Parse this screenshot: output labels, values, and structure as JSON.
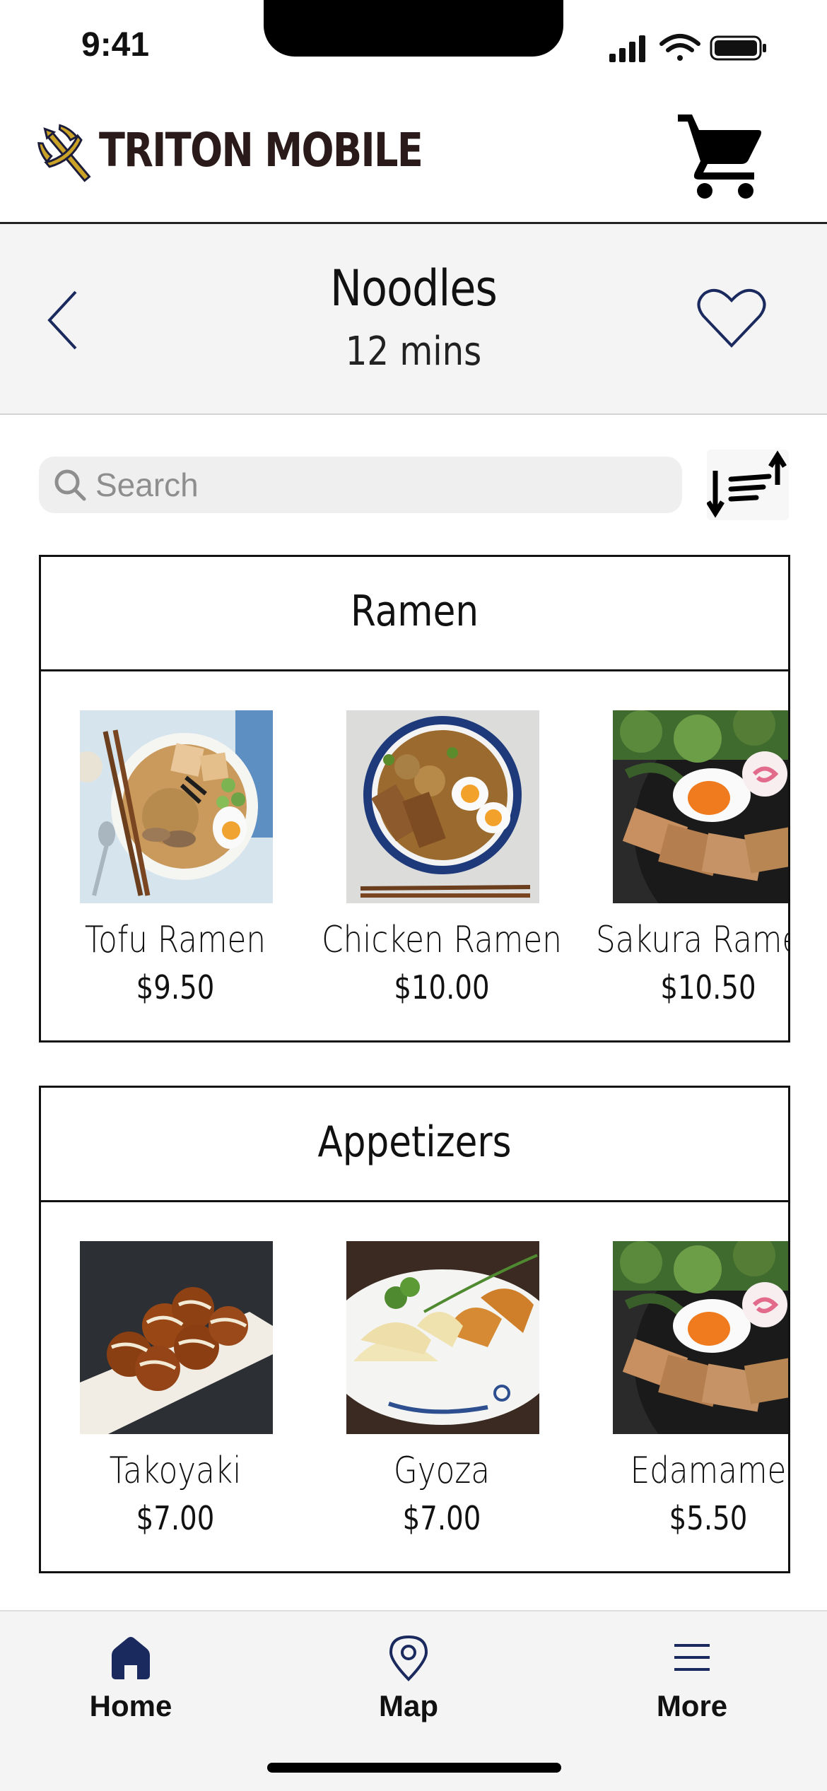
{
  "status_bar": {
    "time": "9:41"
  },
  "brand": {
    "name": "TRITON MOBILE",
    "accent_color": "#c9a227",
    "navy": "#1b2a5e"
  },
  "header": {
    "cart_icon": "cart-icon"
  },
  "category": {
    "title": "Noodles",
    "subtitle": "12 mins",
    "back_icon": "chevron-left-icon",
    "favorite_icon": "heart-icon"
  },
  "search": {
    "placeholder": "Search",
    "value": "",
    "sort_icon": "sort-icon"
  },
  "sections": [
    {
      "title": "Ramen",
      "items": [
        {
          "name": "Tofu Ramen",
          "price": "$9.50"
        },
        {
          "name": "Chicken Ramen",
          "price": "$10.00"
        },
        {
          "name": "Sakura Ramen",
          "price": "$10.50"
        }
      ]
    },
    {
      "title": "Appetizers",
      "items": [
        {
          "name": "Takoyaki",
          "price": "$7.00"
        },
        {
          "name": "Gyoza",
          "price": "$7.00"
        },
        {
          "name": "Edamame",
          "price": "$5.50"
        }
      ]
    }
  ],
  "tabs": [
    {
      "label": "Home",
      "icon": "home-icon",
      "active": true
    },
    {
      "label": "Map",
      "icon": "map-pin-icon",
      "active": false
    },
    {
      "label": "More",
      "icon": "menu-icon",
      "active": false
    }
  ]
}
